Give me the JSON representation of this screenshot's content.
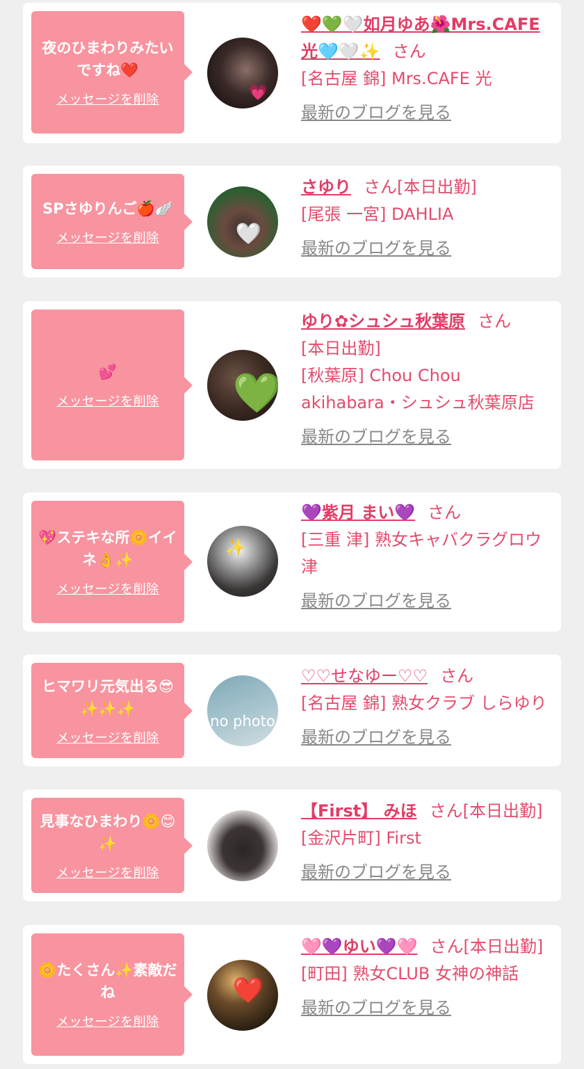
{
  "colors": {
    "bubble": "#f8949f",
    "accent": "#e03d66",
    "link_gray": "#888888",
    "background": "#efefef"
  },
  "items": [
    {
      "message": "夜のひまわりみたいですね❤️",
      "delete_label": "メッセージを削除",
      "name": "❤️💚🤍如月ゆあ🌺Mrs.CAFE光🩵🤍✨",
      "san": "さん",
      "shop": "[名古屋 錦] Mrs.CAFE 光",
      "blog_label": "最新のブログを見る",
      "avatar_icon": "face-avatar-pink-mask"
    },
    {
      "message": "SPさゆりんご🍎🪽",
      "delete_label": "メッセージを削除",
      "name": "さゆり",
      "san": "さん[本日出勤]",
      "shop": "[尾張 一宮] DAHLIA",
      "blog_label": "最新のブログを見る",
      "avatar_icon": "face-avatar-white-heart"
    },
    {
      "message": "💕",
      "delete_label": "メッセージを削除",
      "name": "ゆり✿シュシュ秋葉原",
      "san": "さん",
      "status": "[本日出勤]",
      "shop": "[秋葉原] Chou Chou akihabara・シュシュ秋葉原店",
      "blog_label": "最新のブログを見る",
      "avatar_icon": "face-avatar-green-heart"
    },
    {
      "message": "💖ステキな所🌼イイネ👌✨",
      "delete_label": "メッセージを削除",
      "name": "💜紫月 まい💜",
      "san": "さん",
      "shop": "[三重 津] 熟女キャバクラグロウ津",
      "blog_label": "最新のブログを見る",
      "avatar_icon": "face-avatar-sparkle"
    },
    {
      "message": "ヒマワリ元気出る😎✨✨✨",
      "delete_label": "メッセージを削除",
      "name": "♡♡せなゆー♡♡",
      "san": "さん",
      "shop": "[名古屋 錦] 熟女クラブ しらゆり",
      "blog_label": "最新のブログを見る",
      "avatar_icon": "no-photo-avatar",
      "avatar_text": "no photo"
    },
    {
      "message": "見事なひまわり🌼😊✨",
      "delete_label": "メッセージを削除",
      "name": "【First】 みほ",
      "san": "さん[本日出勤]",
      "shop": "[金沢片町] First",
      "blog_label": "最新のブログを見る",
      "avatar_icon": "hair-avatar"
    },
    {
      "message": "🌼たくさん✨素敵だね",
      "delete_label": "メッセージを削除",
      "name": "🩷💜ゆい💜🩷",
      "san": "さん[本日出勤]",
      "shop": "[町田] 熟女CLUB 女神の神話",
      "blog_label": "最新のブログを見る",
      "avatar_icon": "face-avatar-red-heart"
    }
  ]
}
